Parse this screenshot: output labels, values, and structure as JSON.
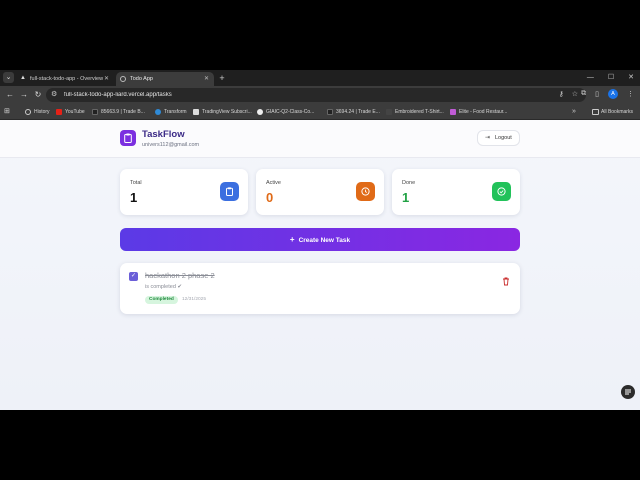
{
  "browser": {
    "tabs": [
      {
        "title": "full-stack-todo-app - Overview",
        "active": false
      },
      {
        "title": "Todo App",
        "active": true
      }
    ],
    "new_tab": "+",
    "window_controls": [
      "—",
      "☐",
      "✕"
    ],
    "url": "full-stack-todo-app-liard.vercel.app/tasks",
    "avatar_letter": "A",
    "bookmarks": [
      "History",
      "YouTube",
      "85663.9 | Trade B...",
      "Transform",
      "TradingView Subscri...",
      "GIAIC-Q2-Class-Co...",
      "3694.24 | Trade E...",
      "Embroidered T-Shirt...",
      "Elite - Food Restaur..."
    ],
    "bookmarks_more": "»",
    "all_bookmarks": "All Bookmarks"
  },
  "app": {
    "brand": "TaskFlow",
    "email": "univers112@gmail.com",
    "logout_label": "Logout",
    "stats": [
      {
        "label": "Total",
        "value": "1",
        "color": "#111111",
        "icon_bg": "#3b6fe0",
        "icon": "clipboard-icon"
      },
      {
        "label": "Active",
        "value": "0",
        "color": "#e06a17",
        "icon_bg": "#e06a17",
        "icon": "clock-icon"
      },
      {
        "label": "Done",
        "value": "1",
        "color": "#22a245",
        "icon_bg": "#22c25a",
        "icon": "check-circle-icon"
      }
    ],
    "create_label": "Create New Task",
    "tasks": [
      {
        "title": "hackathon 2 phase 2",
        "description": "is completed ✔",
        "status": "Completed",
        "date": "12/31/2025",
        "completed": true
      }
    ]
  }
}
